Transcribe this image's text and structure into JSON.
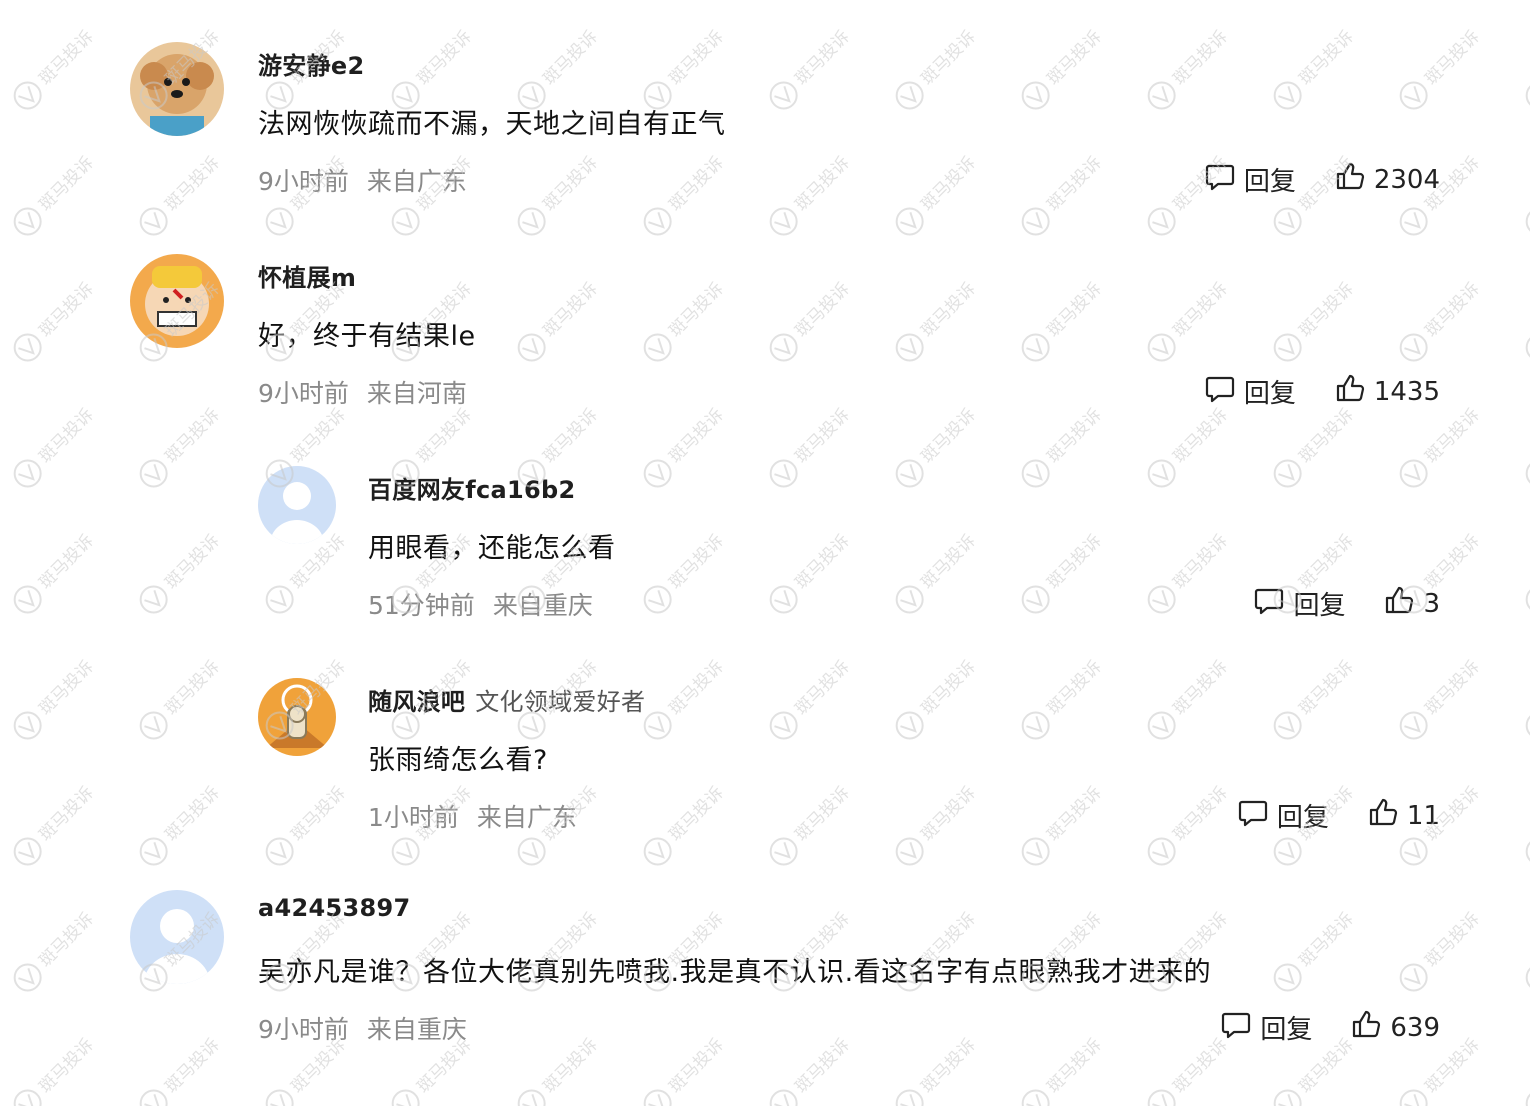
{
  "comments": [
    {
      "user": "游安静e2",
      "badge": "",
      "text": "法网恢恢疏而不漏，天地之间自有正气",
      "time": "9小时前",
      "location": "来自广东",
      "reply_label": "回复",
      "likes": "2304",
      "avatar": "dog-photo"
    },
    {
      "user": "怀植展m",
      "badge": "",
      "text": "好，终于有结果le",
      "time": "9小时前",
      "location": "来自河南",
      "reply_label": "回复",
      "likes": "1435",
      "avatar": "cartoon-face"
    },
    {
      "user": "百度网友fca16b2",
      "badge": "",
      "text": "用眼看，还能怎么看",
      "time": "51分钟前",
      "location": "来自重庆",
      "reply_label": "回复",
      "likes": "3",
      "avatar": "default-user"
    },
    {
      "user": "随风浪吧",
      "badge": "文化领域爱好者",
      "text": "张雨绮怎么看?",
      "time": "1小时前",
      "location": "来自广东",
      "reply_label": "回复",
      "likes": "11",
      "avatar": "mummy-cartoon"
    },
    {
      "user": "a42453897",
      "badge": "",
      "text": "吴亦凡是谁？各位大佬真别先喷我.我是真不认识.看这名字有点眼熟我才进来的",
      "time": "9小时前",
      "location": "来自重庆",
      "reply_label": "回复",
      "likes": "639",
      "avatar": "default-user"
    }
  ],
  "icons": {
    "reply": "speech-bubble-icon",
    "like": "thumbs-up-icon"
  },
  "watermark": "斑马投诉",
  "colors": {
    "meta": "#8a8a8a",
    "username": "#1f1f1f",
    "avatar_default": "#cfe0f7"
  }
}
